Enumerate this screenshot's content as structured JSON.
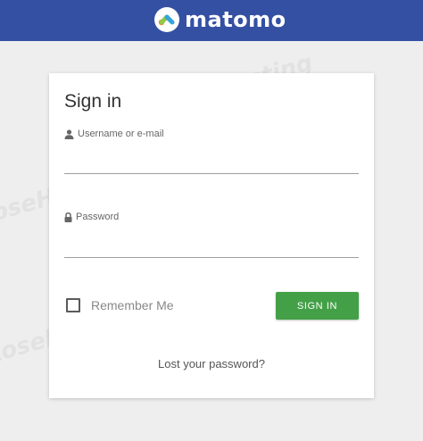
{
  "header": {
    "logo_text": "matomo",
    "background_color": "#3450a3"
  },
  "watermark": {
    "text": "RoseHosting"
  },
  "login": {
    "title": "Sign in",
    "username_label": "Username or e-mail",
    "username_value": "",
    "password_label": "Password",
    "password_value": "",
    "remember_label": "Remember Me",
    "remember_checked": false,
    "submit_label": "SIGN IN",
    "submit_color": "#43a047",
    "lost_password_label": "Lost your password?"
  }
}
